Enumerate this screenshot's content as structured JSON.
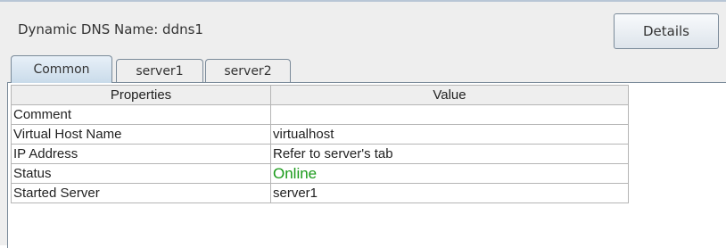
{
  "header": {
    "title": "Dynamic DNS Name: ddns1",
    "details_label": "Details"
  },
  "tabs": [
    {
      "label": "Common",
      "active": true
    },
    {
      "label": "server1",
      "active": false
    },
    {
      "label": "server2",
      "active": false
    }
  ],
  "table": {
    "columns": [
      "Properties",
      "Value"
    ],
    "rows": [
      {
        "property": "Comment",
        "value": ""
      },
      {
        "property": "Virtual Host Name",
        "value": "virtualhost"
      },
      {
        "property": "IP Address",
        "value": "Refer to server's tab"
      },
      {
        "property": "Status",
        "value": "Online"
      },
      {
        "property": "Started Server",
        "value": "server1"
      }
    ]
  },
  "colors": {
    "status_online": "#1a9a1a",
    "active_tab": "#c9dbea"
  }
}
